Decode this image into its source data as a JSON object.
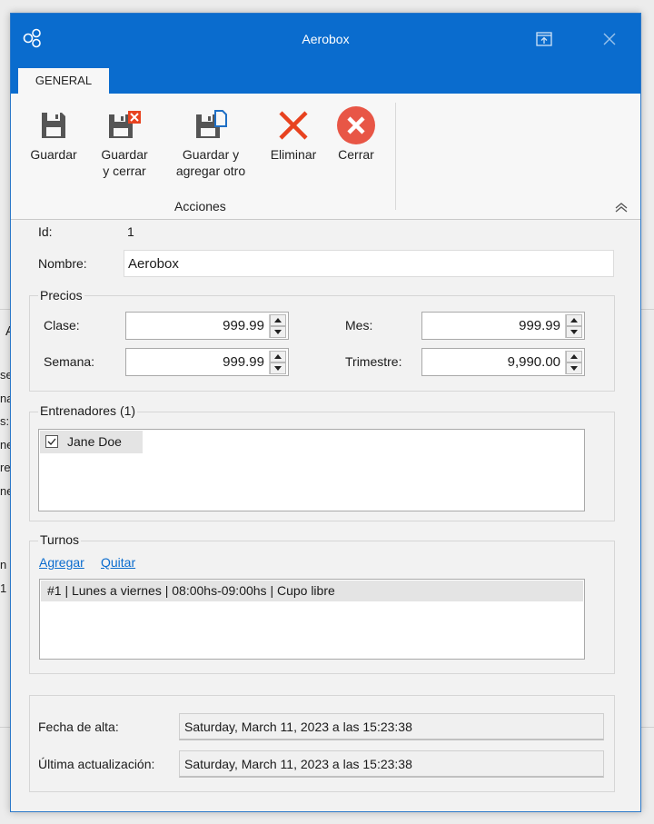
{
  "window": {
    "title": "Aerobox"
  },
  "tabs": [
    {
      "label": "GENERAL"
    }
  ],
  "ribbon": {
    "buttons": [
      {
        "label": "Guardar",
        "icon": "save-icon"
      },
      {
        "label": "Guardar\ny cerrar",
        "icon": "save-close-icon"
      },
      {
        "label": "Guardar y\nagregar otro",
        "icon": "save-new-icon"
      },
      {
        "label": "Eliminar",
        "icon": "delete-icon"
      },
      {
        "label": "Cerrar",
        "icon": "close-circle-icon"
      }
    ],
    "group_label": "Acciones"
  },
  "form": {
    "id_label": "Id:",
    "id_value": "1",
    "nombre_label": "Nombre:",
    "nombre_value": "Aerobox",
    "precios": {
      "legend": "Precios",
      "clase_label": "Clase:",
      "clase_value": "999.99",
      "mes_label": "Mes:",
      "mes_value": "999.99",
      "semana_label": "Semana:",
      "semana_value": "999.99",
      "trimestre_label": "Trimestre:",
      "trimestre_value": "9,990.00"
    },
    "entrenadores": {
      "legend": "Entrenadores (1)",
      "items": [
        {
          "label": "Jane Doe",
          "checked": true
        }
      ]
    },
    "turnos": {
      "legend": "Turnos",
      "add_link": "Agregar",
      "remove_link": "Quitar",
      "items": [
        "#1 | Lunes a viernes | 08:00hs-09:00hs | Cupo libre"
      ]
    },
    "fechas": {
      "alta_label": "Fecha de alta:",
      "alta_value": "Saturday, March 11, 2023 a las 15:23:38",
      "actualizacion_label": "Última actualización:",
      "actualizacion_value": "Saturday, March 11, 2023 a las 15:23:38"
    }
  },
  "background": {
    "fragments": [
      "A",
      "se",
      "na",
      "s:",
      "ne",
      "re",
      "ne",
      "n",
      "1"
    ]
  },
  "colors": {
    "accent": "#0a6cce",
    "delete": "#e8421f",
    "close": "#e85646"
  }
}
